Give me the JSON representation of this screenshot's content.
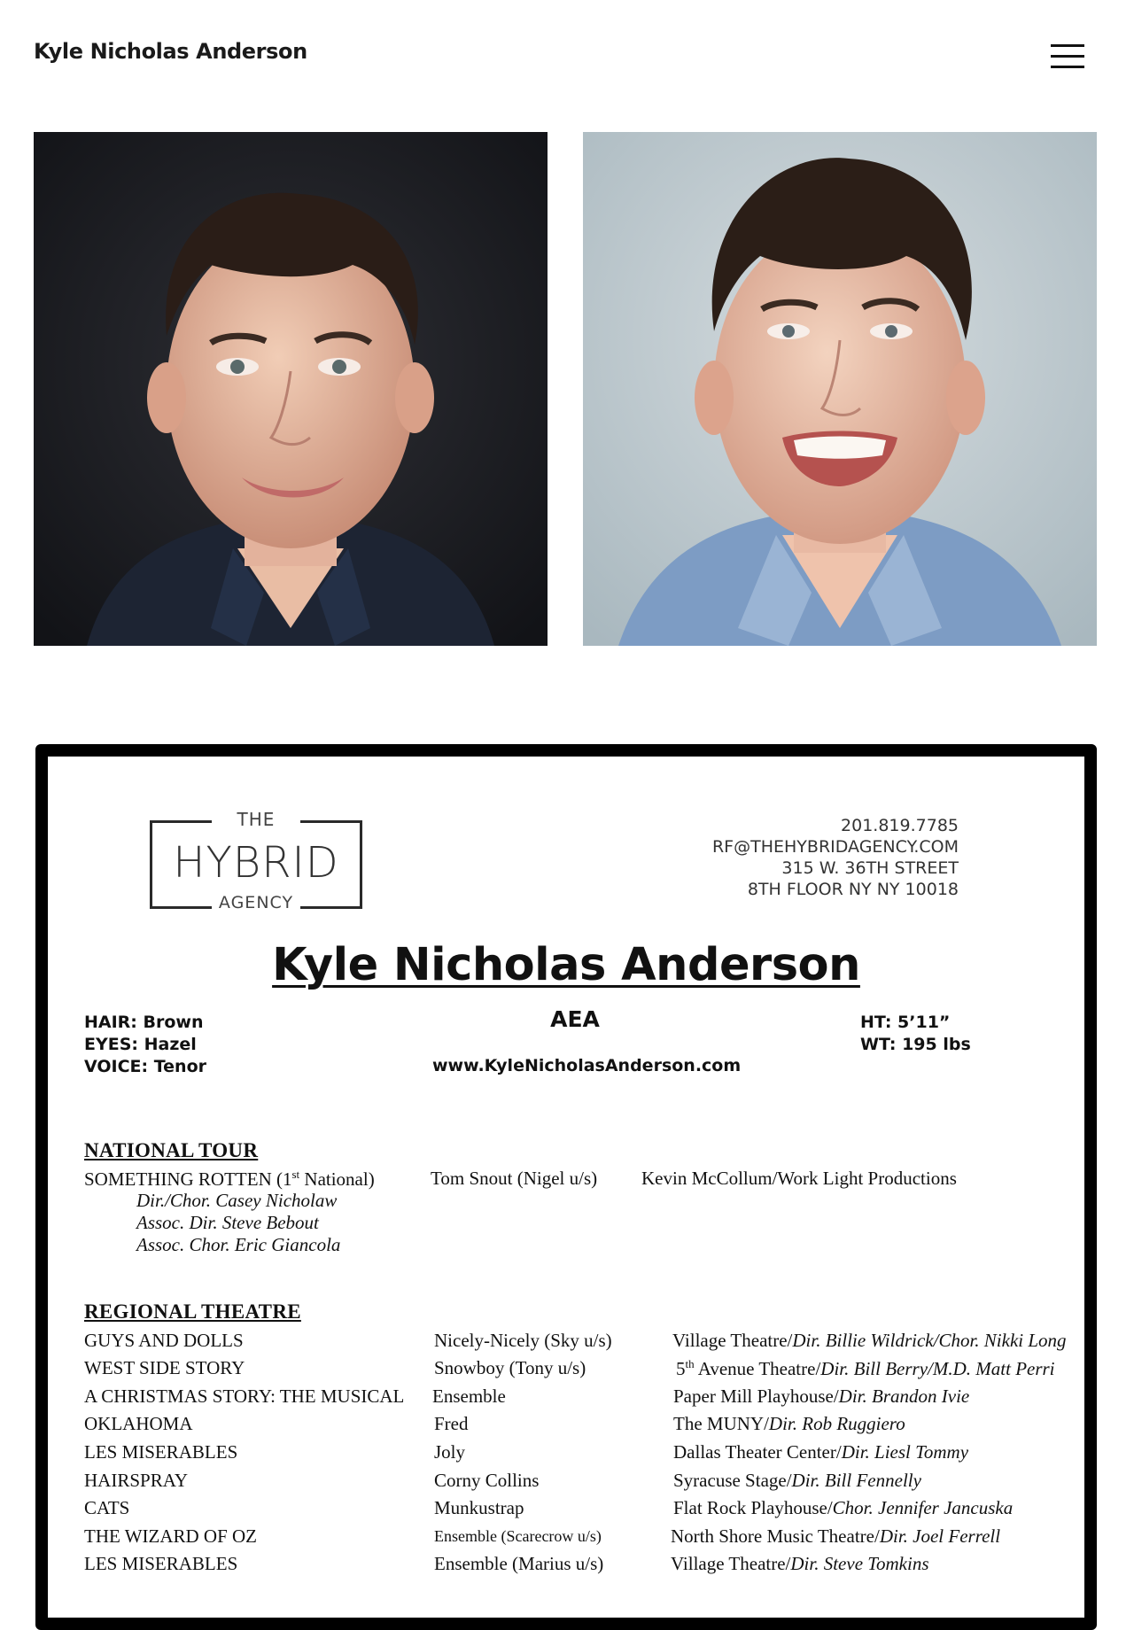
{
  "header": {
    "site_title": "Kyle Nicholas Anderson"
  },
  "resume": {
    "agency": {
      "logo_top": "THE",
      "logo_main": "HYBRID",
      "logo_bottom": "AGENCY",
      "phone": "201.819.7785",
      "email": "RF@THEHYBRIDAGENCY.COM",
      "address1": "315 W. 36TH STREET",
      "address2": "8TH FLOOR NY NY 10018"
    },
    "name": "Kyle Nicholas Anderson",
    "union": "AEA",
    "website": "www.KyleNicholasAnderson.com",
    "hair": "HAIR: Brown",
    "eyes": "EYES: Hazel",
    "voice": "VOICE: Tenor",
    "height": "HT: 5’11”",
    "weight": "WT: 195 lbs",
    "national_tour": {
      "heading": "NATIONAL TOUR",
      "show_pre": "SOMETHING ROTTEN (1",
      "show_sup": "st",
      "show_post": " National)",
      "role": "Tom Snout (Nigel u/s)",
      "venue": "Kevin McCollum/Work Light Productions",
      "credits": [
        "Dir./Chor. Casey Nicholaw",
        "Assoc. Dir. Steve Bebout",
        "Assoc. Chor. Eric Giancola"
      ]
    },
    "regional": {
      "heading": "REGIONAL THEATRE",
      "rows": [
        {
          "show": "GUYS AND DOLLS",
          "role": "Nicely-Nicely (Sky u/s)",
          "venue": "Village Theatre/",
          "credit": "Dir. Billie Wildrick/Chor. Nikki Long"
        },
        {
          "show": "WEST SIDE STORY",
          "role": "Snowboy (Tony u/s)",
          "venue_sup_num": "5",
          "venue_sup": "th",
          "venue": " Avenue Theatre/",
          "credit": "Dir. Bill Berry/M.D. Matt Perri"
        },
        {
          "show": "A CHRISTMAS STORY: THE MUSICAL",
          "role": "Ensemble",
          "venue": "Paper Mill Playhouse/",
          "credit": "Dir. Brandon Ivie"
        },
        {
          "show": "OKLAHOMA",
          "role": "Fred",
          "venue": "The MUNY/",
          "credit": "Dir. Rob Ruggiero"
        },
        {
          "show": "LES MISERABLES",
          "role": "Joly",
          "venue": "Dallas Theater Center/",
          "credit": "Dir. Liesl Tommy"
        },
        {
          "show": "HAIRSPRAY",
          "role": "Corny Collins",
          "venue": "Syracuse Stage/",
          "credit": "Dir. Bill Fennelly"
        },
        {
          "show": "CATS",
          "role": "Munkustrap",
          "venue": "Flat Rock Playhouse/",
          "credit": "Chor. Jennifer Jancuska"
        },
        {
          "show": "THE WIZARD OF OZ",
          "role": "Ensemble (Scarecrow u/s)",
          "venue": "North Shore Music Theatre/",
          "credit": "Dir. Joel Ferrell"
        },
        {
          "show": "LES MISERABLES",
          "role": "Ensemble (Marius u/s)",
          "venue": "Village Theatre/",
          "credit": "Dir. Steve Tomkins"
        }
      ]
    }
  },
  "colors": {
    "photo1_bg": "#1c1d22",
    "photo2_bg": "#b8c6cc",
    "frame": "#000000"
  },
  "icons": {
    "menu": "hamburger-menu-icon"
  }
}
